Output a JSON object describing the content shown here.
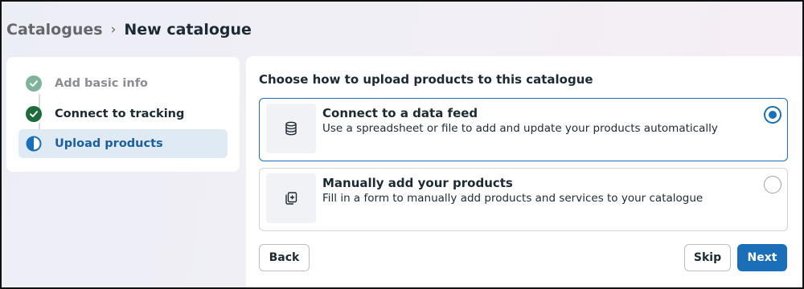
{
  "breadcrumb": {
    "parent": "Catalogues",
    "separator": "›",
    "current": "New catalogue"
  },
  "steps": [
    {
      "label": "Add basic info",
      "state": "done-faded",
      "icon": "check-circle-icon"
    },
    {
      "label": "Connect to tracking",
      "state": "done",
      "icon": "check-circle-icon"
    },
    {
      "label": "Upload products",
      "state": "active",
      "icon": "half-circle-icon"
    }
  ],
  "main": {
    "title": "Choose how to upload products to this catalogue",
    "options": [
      {
        "title": "Connect to a data feed",
        "description": "Use a spreadsheet or file to add and update your products automatically",
        "selected": true,
        "icon": "database-icon"
      },
      {
        "title": "Manually add your products",
        "description": "Fill in a form to manually add products and services to your catalogue",
        "selected": false,
        "icon": "add-card-icon"
      }
    ]
  },
  "buttons": {
    "back": "Back",
    "skip": "Skip",
    "next": "Next"
  },
  "colors": {
    "accent": "#1a6fb8",
    "done_green": "#1e6b3c",
    "faded_green": "#7fb39a",
    "active_bg": "#dfeaf5"
  }
}
